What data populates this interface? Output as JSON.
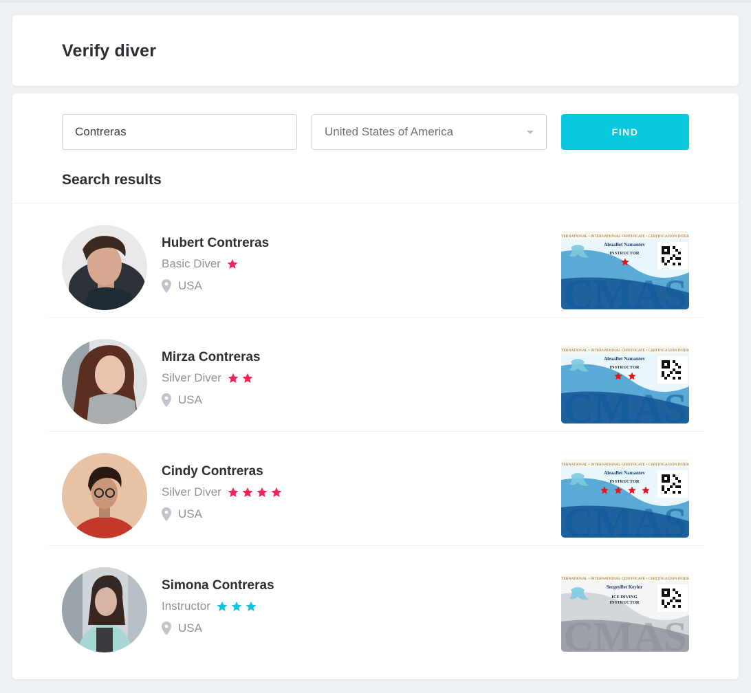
{
  "header": {
    "title": "Verify diver"
  },
  "search": {
    "name_value": "Contreras",
    "country_value": "United States of America",
    "find_label": "FIND"
  },
  "results": {
    "title": "Search results",
    "items": [
      {
        "name": "Hubert Contreras",
        "level": "Basic Diver",
        "stars": 1,
        "star_color": "#f0245a",
        "country": "USA",
        "card": {
          "header": "BREVET INTERNATIONAL • INTERNATIONAL CERTIFICATE • CERTIFICACION INTERNACIONAL",
          "holder": "AleaaBet Namantev",
          "role": "INSTRUCTOR",
          "role2": "",
          "brand": "CMAS",
          "card_stars": 1,
          "theme": "blue"
        }
      },
      {
        "name": "Mirza Contreras",
        "level": "Silver Diver",
        "stars": 2,
        "star_color": "#f0245a",
        "country": "USA",
        "card": {
          "header": "BREVET INTERNATIONAL • INTERNATIONAL CERTIFICATE • CERTIFICACION INTERNACIONAL",
          "holder": "AleaaBet Namantev",
          "role": "INSTRUCTOR",
          "role2": "",
          "brand": "CMAS",
          "card_stars": 2,
          "theme": "blue"
        }
      },
      {
        "name": "Cindy Contreras",
        "level": "Silver Diver",
        "stars": 4,
        "star_color": "#f0245a",
        "country": "USA",
        "card": {
          "header": "BREVET INTERNATIONAL • INTERNATIONAL CERTIFICATE • CERTIFICACION INTERNACIONAL",
          "holder": "AleaaBet Namantev",
          "role": "INSTRUCTOR",
          "role2": "",
          "brand": "CMAS",
          "card_stars": 4,
          "theme": "blue"
        }
      },
      {
        "name": "Simona Contreras",
        "level": "Instructor",
        "stars": 3,
        "star_color": "#10c4dc",
        "country": "USA",
        "card": {
          "header": "BREVET INTERNATIONAL • INTERNATIONAL CERTIFICATE • CERTIFICACION INTERNACIONAL",
          "holder": "SergeyBet Keylor",
          "role": "ICE DIVING",
          "role2": "INSTRUCTOR",
          "brand": "CMAS",
          "card_stars": 0,
          "theme": "silver"
        }
      }
    ]
  },
  "colors": {
    "accent": "#08c8dc",
    "star_pink": "#f0245a",
    "star_cyan": "#10c4dc",
    "muted_text": "#8d9499"
  },
  "icons": {
    "dropdown": "chevron-down-icon",
    "location": "map-pin-icon",
    "rating": "star-icon"
  }
}
